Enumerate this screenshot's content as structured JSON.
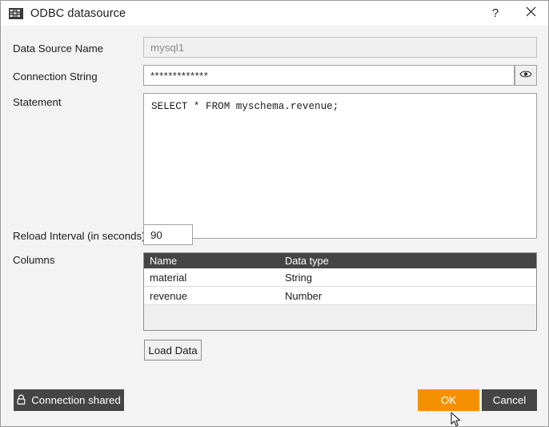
{
  "window": {
    "title": "ODBC datasource",
    "icon": "database-grid-icon",
    "help_label": "?",
    "close_label": "✕",
    "accent_color": "#f59100",
    "dark_color": "#454545",
    "background_color": "#f3f3f3"
  },
  "form": {
    "data_source_name": {
      "label": "Data Source Name",
      "value": "mysql1",
      "placeholder": "mysql1",
      "disabled": true
    },
    "connection_string": {
      "label": "Connection String",
      "value": "*************",
      "placeholder": "",
      "reveal_icon": "eye-icon"
    },
    "statement": {
      "label": "Statement",
      "value": "SELECT * FROM myschema.revenue;",
      "placeholder": ""
    },
    "reload_interval": {
      "label": "Reload Interval (in seconds)",
      "value": "90",
      "placeholder": ""
    },
    "columns": {
      "label": "Columns",
      "headers": [
        "Name",
        "Data type"
      ],
      "rows": [
        {
          "name": "material",
          "data_type": "String"
        },
        {
          "name": "revenue",
          "data_type": "Number"
        }
      ]
    },
    "load_data_label": "Load Data"
  },
  "footer": {
    "connection_shared_label": "Connection shared",
    "connection_shared_icon": "lock-icon",
    "ok_label": "OK",
    "cancel_label": "Cancel"
  }
}
